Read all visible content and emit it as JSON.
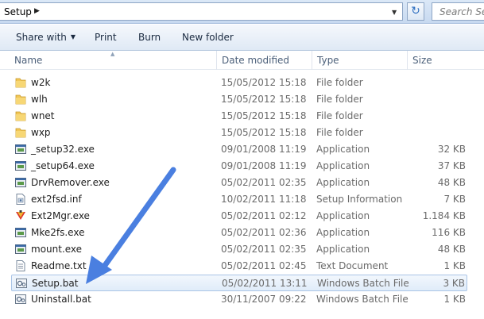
{
  "address": {
    "crumb": "Setup",
    "search_placeholder": "Search Setu"
  },
  "commands": {
    "share_with": "Share with",
    "print": "Print",
    "burn": "Burn",
    "new_folder": "New folder"
  },
  "columns": {
    "name": "Name",
    "date": "Date modified",
    "type": "Type",
    "size": "Size"
  },
  "files": [
    {
      "name": "w2k",
      "date": "15/05/2012 15:18",
      "type": "File folder",
      "size": "",
      "icon": "folder-icon"
    },
    {
      "name": "wlh",
      "date": "15/05/2012 15:18",
      "type": "File folder",
      "size": "",
      "icon": "folder-icon"
    },
    {
      "name": "wnet",
      "date": "15/05/2012 15:18",
      "type": "File folder",
      "size": "",
      "icon": "folder-icon"
    },
    {
      "name": "wxp",
      "date": "15/05/2012 15:18",
      "type": "File folder",
      "size": "",
      "icon": "folder-icon"
    },
    {
      "name": "_setup32.exe",
      "date": "09/01/2008 11:19",
      "type": "Application",
      "size": "32 KB",
      "icon": "app-icon"
    },
    {
      "name": "_setup64.exe",
      "date": "09/01/2008 11:19",
      "type": "Application",
      "size": "37 KB",
      "icon": "app-icon"
    },
    {
      "name": "DrvRemover.exe",
      "date": "05/02/2011 02:35",
      "type": "Application",
      "size": "48 KB",
      "icon": "app-icon"
    },
    {
      "name": "ext2fsd.inf",
      "date": "10/02/2011 11:18",
      "type": "Setup Information",
      "size": "7 KB",
      "icon": "inf-icon"
    },
    {
      "name": "Ext2Mgr.exe",
      "date": "05/02/2011 02:12",
      "type": "Application",
      "size": "1.184 KB",
      "icon": "ext2mgr-icon"
    },
    {
      "name": "Mke2fs.exe",
      "date": "05/02/2011 02:36",
      "type": "Application",
      "size": "116 KB",
      "icon": "app-icon"
    },
    {
      "name": "mount.exe",
      "date": "05/02/2011 02:35",
      "type": "Application",
      "size": "48 KB",
      "icon": "app-icon"
    },
    {
      "name": "Readme.txt",
      "date": "05/02/2011 02:45",
      "type": "Text Document",
      "size": "1 KB",
      "icon": "text-icon"
    },
    {
      "name": "Setup.bat",
      "date": "05/02/2011 13:11",
      "type": "Windows Batch File",
      "size": "3 KB",
      "icon": "batch-icon",
      "selected": true
    },
    {
      "name": "Uninstall.bat",
      "date": "30/11/2007 09:22",
      "type": "Windows Batch File",
      "size": "1 KB",
      "icon": "batch-icon"
    }
  ],
  "colors": {
    "arrow": "#4a7fe0",
    "selection": "#dcebfc",
    "folder": "#f1c656"
  }
}
